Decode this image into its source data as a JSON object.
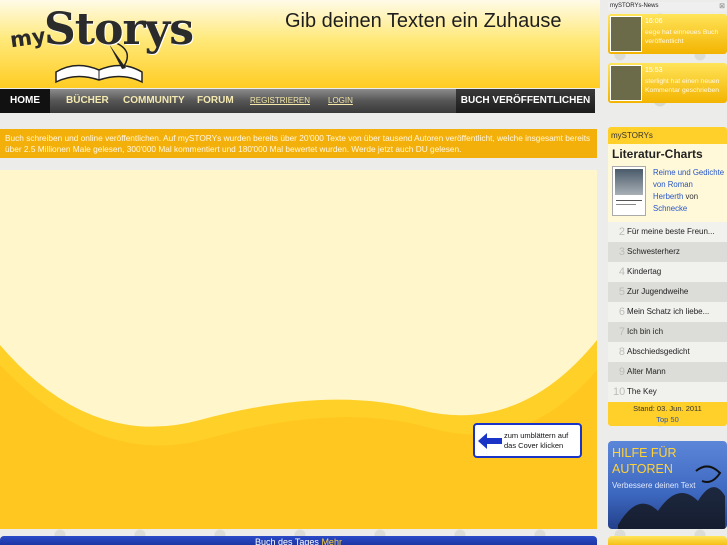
{
  "header": {
    "logo_my": "my",
    "logo_storys": "Storys",
    "tagline": "Gib deinen Texten ein Zuhause"
  },
  "nav": {
    "home": "HOME",
    "books": "BÜCHER",
    "community": "COMMUNITY",
    "forum": "FORUM",
    "register": "REGISTRIEREN",
    "login": "LOGIN",
    "publish": "BUCH VERÖFFENTLICHEN"
  },
  "intro": "Buch schreiben und online veröffentlichen. Auf mySTORYs wurden bereits über 20'000 Texte von über tausend Autoren veröffentlicht, welche insgesamt bereits über 2.5 Millionen Male gelesen, 300'000 Mal kommentiert und 180'000 Mal bewertet wurden. Werde jetzt auch DU gelesen.",
  "flip_hint": "zum umblättern auf das Cover klicken",
  "book_of_day": {
    "label": "Buch des Tages",
    "more": "Mehr"
  },
  "news": {
    "title": "mySTORYs-News",
    "items": [
      {
        "time": "16:06",
        "text": "eege hat einneues Buch veröffentlicht"
      },
      {
        "time": "15:53",
        "text": "sterlight hat einen neuen Kommentar geschrieben"
      }
    ]
  },
  "charts": {
    "brand": "mySTORYs",
    "title": "Literatur-Charts",
    "top": {
      "book": "Reime und Gedichte von Roman Herberth",
      "by": "von",
      "user": "Schnecke"
    },
    "items": [
      {
        "rank": "2",
        "title": "Für meine beste Freun..."
      },
      {
        "rank": "3",
        "title": "Schwesterherz"
      },
      {
        "rank": "4",
        "title": "Kindertag"
      },
      {
        "rank": "5",
        "title": "Zur Jugendweihe"
      },
      {
        "rank": "6",
        "title": "Mein Schatz ich liebe..."
      },
      {
        "rank": "7",
        "title": "Ich bin ich"
      },
      {
        "rank": "8",
        "title": "Abschiedsgedicht"
      },
      {
        "rank": "9",
        "title": "Alter Mann"
      },
      {
        "rank": "10",
        "title": "The Key"
      }
    ],
    "stand": "Stand: 03. Jun. 2011",
    "top50": "Top 50"
  },
  "help": {
    "title": "HILFE FÜR AUTOREN",
    "subtitle": "Verbessere deinen Text"
  },
  "colors": {
    "accent_yellow": "#ffcc22",
    "nav_dark": "#3a3a3a",
    "info_orange": "#f4b00a",
    "link_blue": "#2656c8",
    "help_blue": "#3d68c0"
  }
}
